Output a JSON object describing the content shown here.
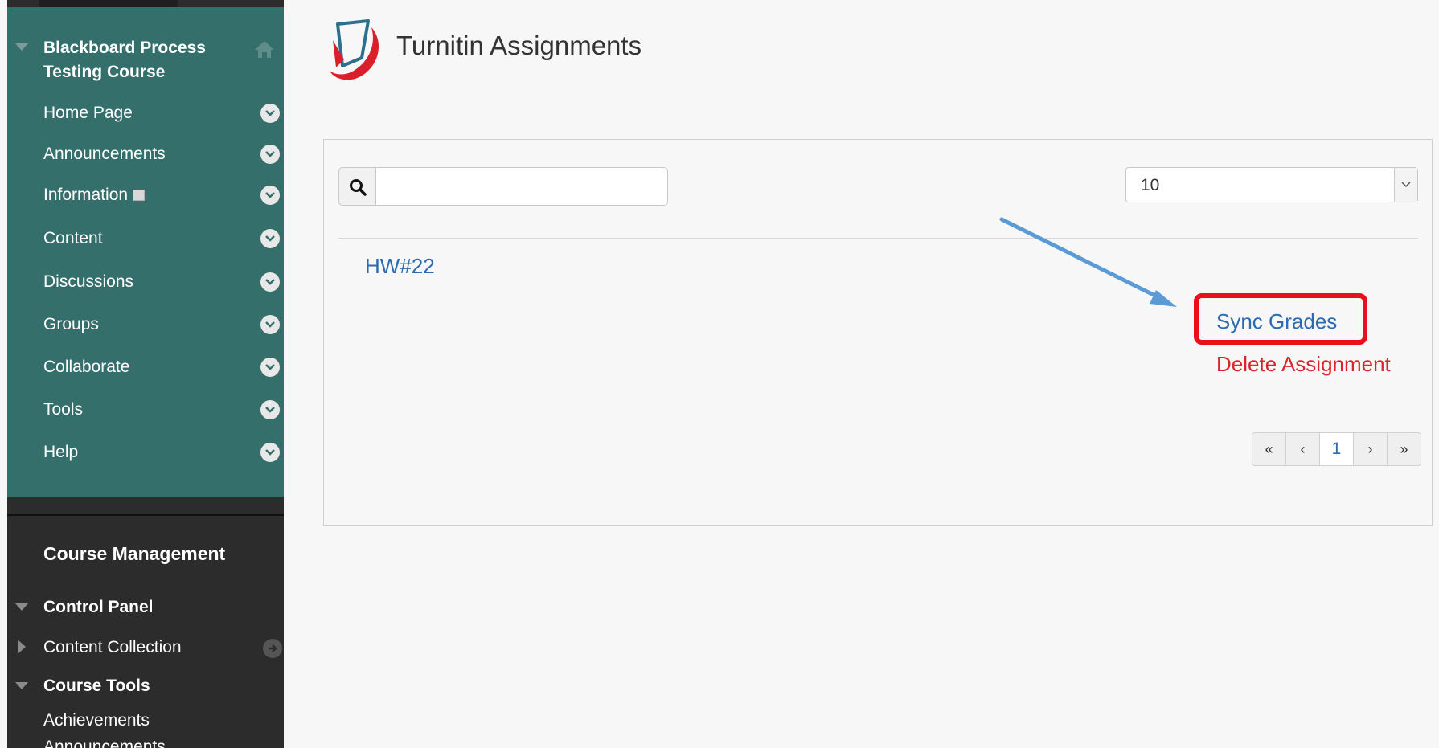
{
  "sidebar": {
    "course_title": "Blackboard Process Testing Course",
    "items": [
      {
        "label": "Home Page"
      },
      {
        "label": "Announcements"
      },
      {
        "label": "Information"
      },
      {
        "label": "Content"
      },
      {
        "label": "Discussions"
      },
      {
        "label": "Groups"
      },
      {
        "label": "Collaborate"
      },
      {
        "label": "Tools"
      },
      {
        "label": "Help"
      }
    ],
    "management_title": "Course Management",
    "control_panel": "Control Panel",
    "content_collection": "Content Collection",
    "course_tools": "Course Tools",
    "course_tool_items": [
      "Achievements",
      "Announcements"
    ]
  },
  "header": {
    "title": "Turnitin Assignments"
  },
  "list": {
    "search_placeholder": "",
    "page_size": "10",
    "assignment": "HW#22",
    "sync_label": "Sync Grades",
    "delete_label": "Delete Assignment"
  },
  "pagination": {
    "first": "«",
    "prev": "‹",
    "current": "1",
    "next": "›",
    "last": "»"
  },
  "colors": {
    "sidebar_menu": "#346f6c",
    "sidebar_dark": "#2c2c2c",
    "link": "#2b6bb0",
    "delete": "#d8252c",
    "highlight": "#e8101a",
    "annotation_arrow": "#5b9bd5"
  },
  "icons": {
    "logo": "turnitin-logo-icon",
    "home": "home-icon",
    "search": "search-icon",
    "menu_chevron": "chevron-down-icon"
  }
}
